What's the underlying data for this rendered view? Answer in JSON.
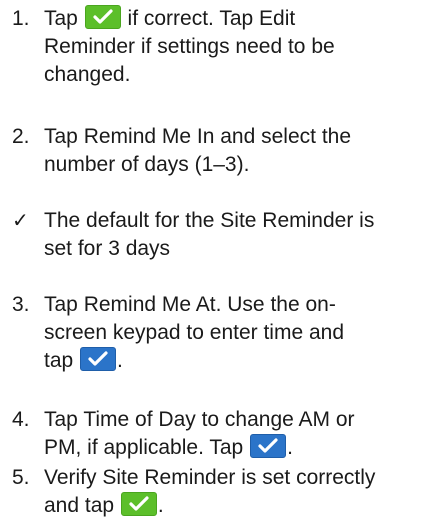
{
  "steps": [
    {
      "marker": "1.",
      "lines": [
        [
          "Tap ",
          {
            "btn": "confirm-green"
          },
          " if correct. Tap ",
          {
            "b": "Edit"
          }
        ],
        [
          {
            "b": "Reminder"
          },
          " if settings need to be"
        ],
        [
          "changed."
        ]
      ]
    },
    {
      "marker": "2.",
      "lines": [
        [
          "Tap ",
          {
            "b": "Remind Me In"
          },
          " and select the"
        ],
        [
          "number of days (1–3)."
        ]
      ]
    },
    {
      "marker": "✓",
      "lines": [
        [
          "The default for the Site Reminder is"
        ],
        [
          "set for 3 days"
        ]
      ]
    },
    {
      "marker": "3.",
      "lines": [
        [
          "Tap ",
          {
            "b": "Remind Me At"
          },
          ". Use the on-"
        ],
        [
          "screen keypad to enter time and"
        ],
        [
          "tap ",
          {
            "btn": "confirm-blue"
          },
          "."
        ]
      ]
    },
    {
      "marker": "4.",
      "lines": [
        [
          "Tap ",
          {
            "b": "Time of Day"
          },
          " to change AM or"
        ],
        [
          "PM, if applicable. Tap ",
          {
            "btn": "confirm-blue"
          },
          "."
        ]
      ]
    },
    {
      "marker": "5.",
      "lines": [
        [
          "Verify Site Reminder is set correctly"
        ],
        [
          "and tap ",
          {
            "btn": "confirm-green"
          },
          "."
        ]
      ]
    }
  ],
  "colors": {
    "text": "#1a1a1a",
    "confirm_green": "#5cbf2a",
    "confirm_blue": "#2b74c9"
  },
  "icons": {
    "confirm-green": "checkmark-icon",
    "confirm-blue": "checkmark-icon"
  }
}
